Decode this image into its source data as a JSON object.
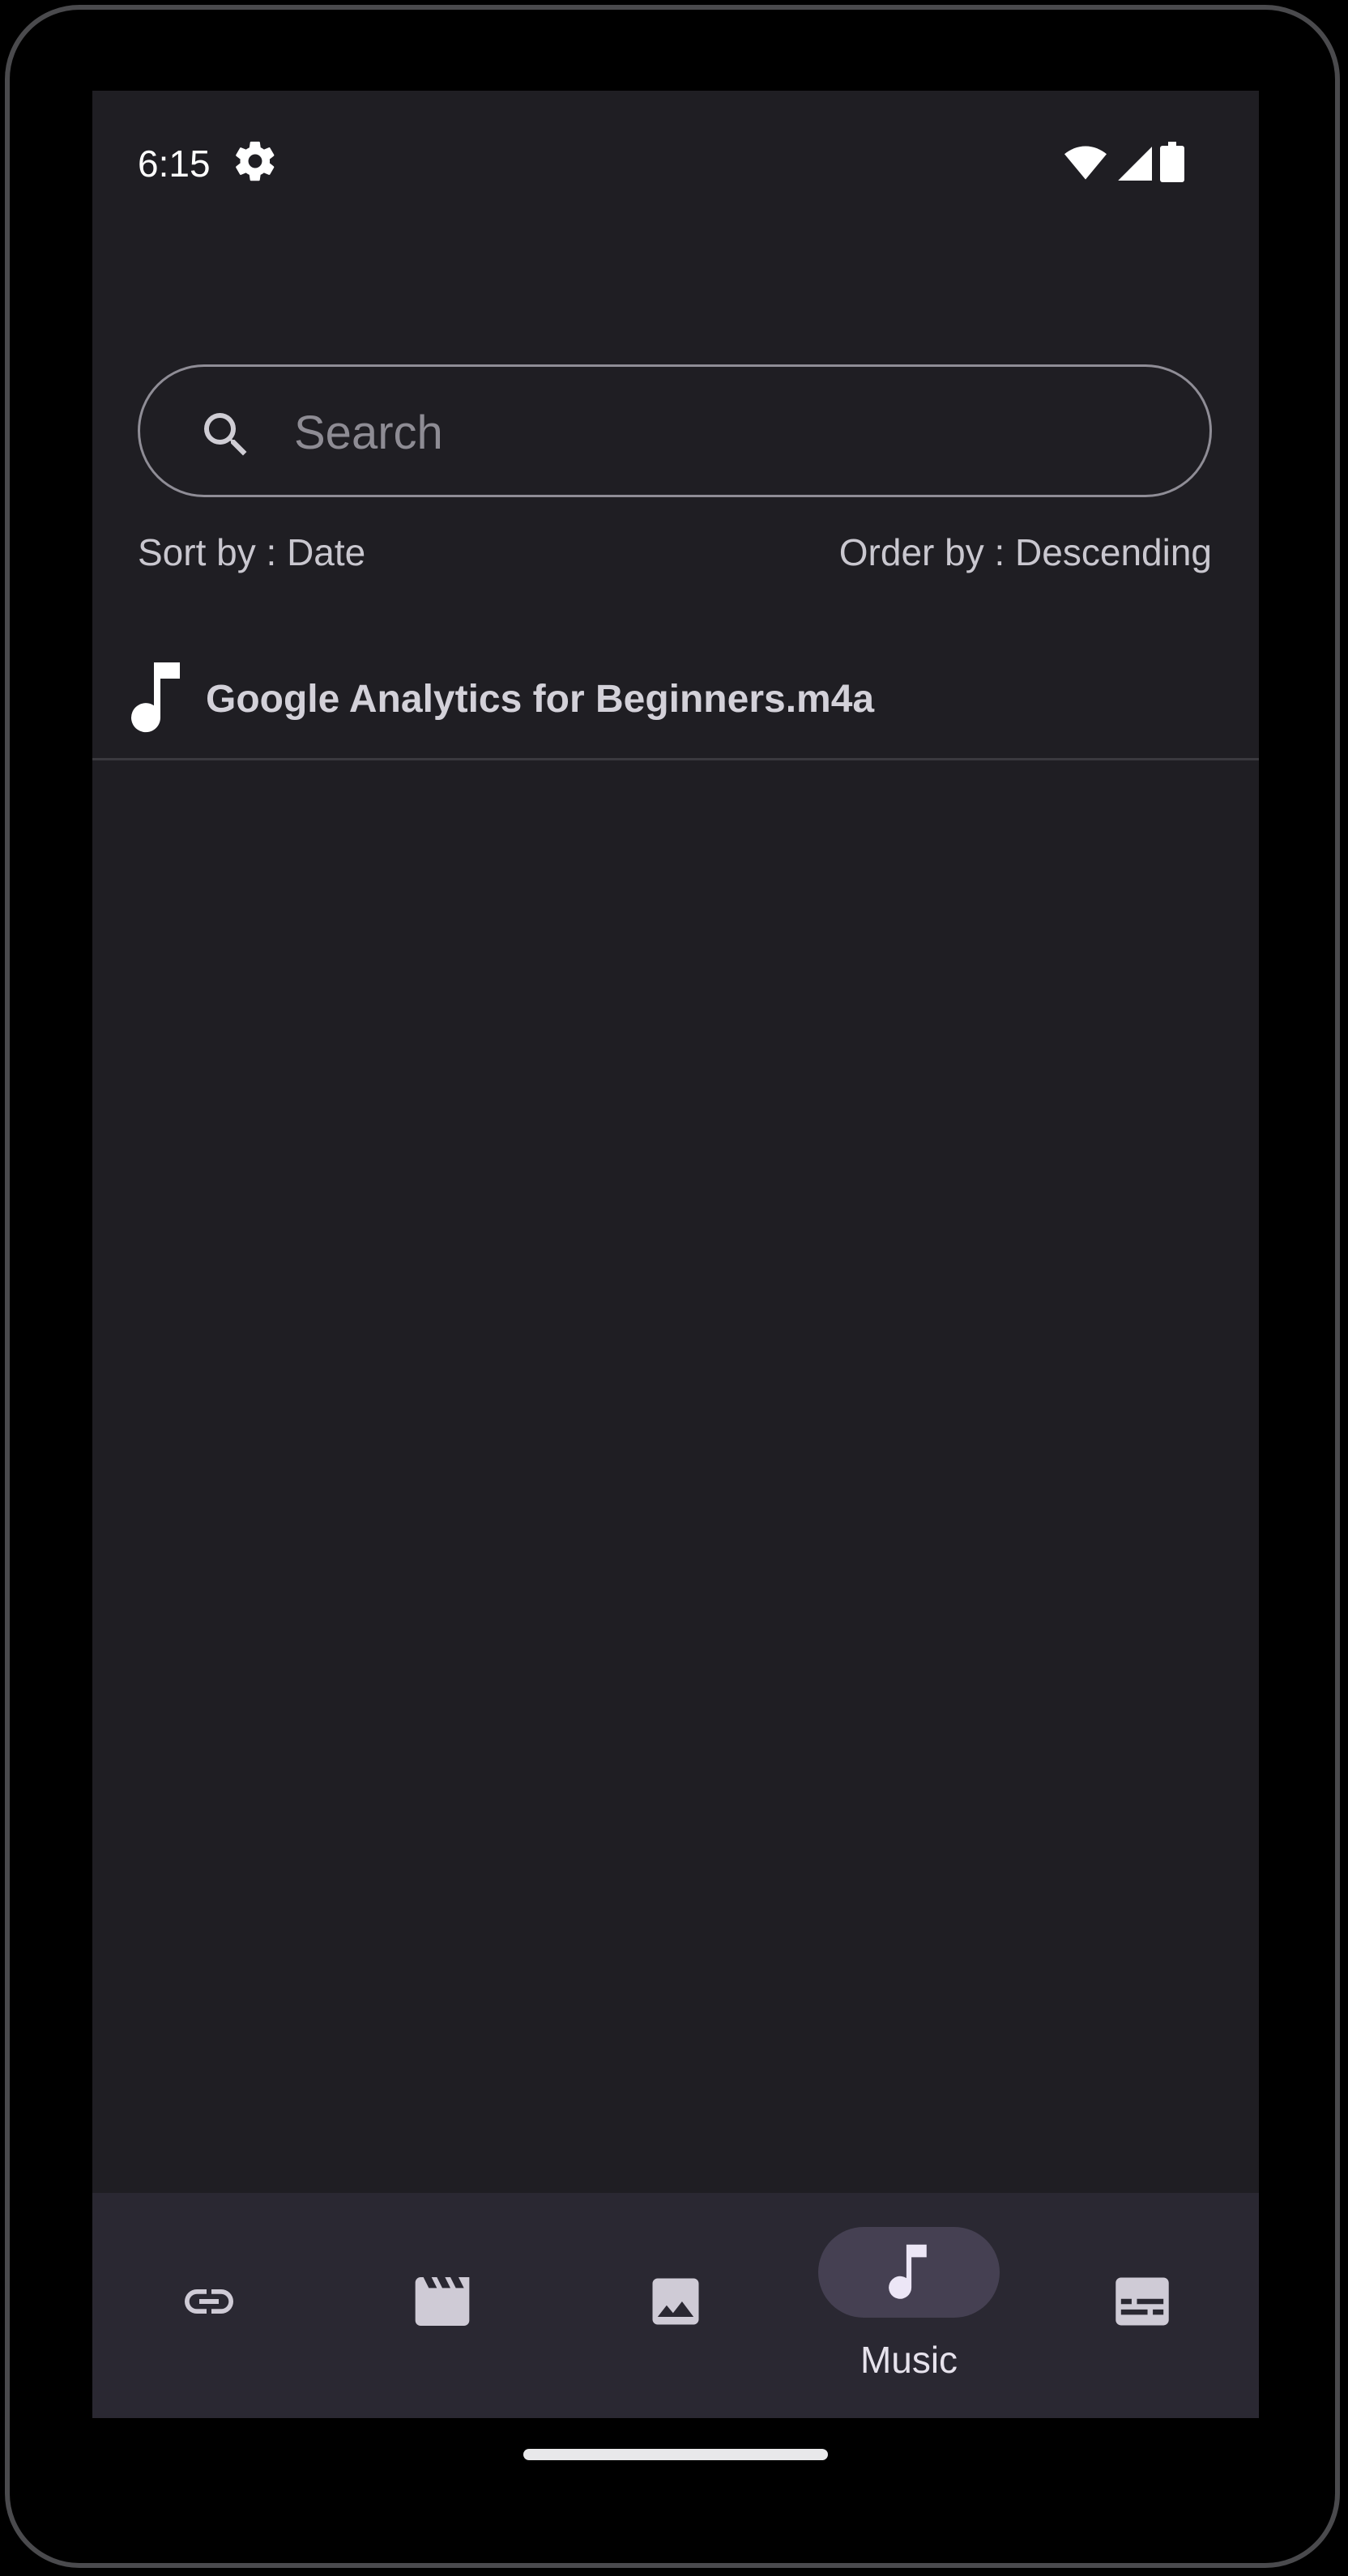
{
  "status_bar": {
    "time": "6:15",
    "icons": [
      "settings-gear-icon",
      "wifi-icon",
      "cell-signal-icon",
      "battery-icon"
    ]
  },
  "search": {
    "placeholder": "Search",
    "value": ""
  },
  "sort": {
    "sort_label": "Sort by : Date",
    "order_label": "Order by : Descending"
  },
  "files": [
    {
      "icon": "music-note-icon",
      "name": "Google Analytics for Beginners.m4a"
    }
  ],
  "bottom_nav": {
    "items": [
      {
        "icon": "link-icon",
        "label": "",
        "selected": false
      },
      {
        "icon": "video-clapperboard-icon",
        "label": "",
        "selected": false
      },
      {
        "icon": "image-icon",
        "label": "",
        "selected": false
      },
      {
        "icon": "music-note-icon",
        "label": "Music",
        "selected": true
      },
      {
        "icon": "subtitles-icon",
        "label": "",
        "selected": false
      }
    ]
  },
  "colors": {
    "background": "#1f1e23",
    "nav_background": "#2a2832",
    "selected_pill": "#454052",
    "text_primary": "#d3d1d9"
  }
}
